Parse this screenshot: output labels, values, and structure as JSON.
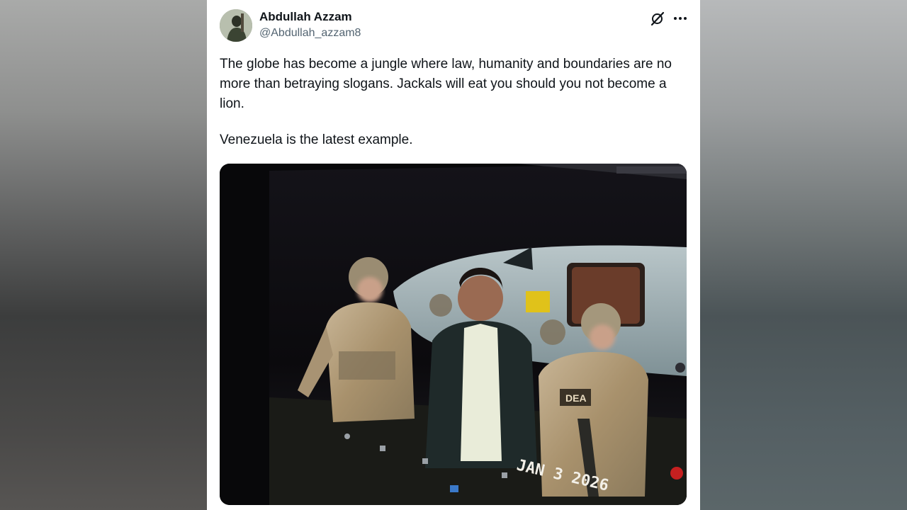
{
  "tweet": {
    "author_name": "Abdullah Azzam",
    "author_handle": "@Abdullah_azzam8",
    "text_paragraphs": [
      "The globe has become a jungle where law, humanity and boundaries are no more than betraying slogans. Jackals will eat you should you not become a lion.",
      "Venezuela is the latest example."
    ],
    "header_icons": [
      "grok-icon",
      "more-icon"
    ]
  },
  "media": {
    "patch_text": "DEA",
    "date_stamp": "JAN 3 2026"
  },
  "colors": {
    "name": "#0f1419",
    "handle": "#536471",
    "card_bg": "#ffffff"
  }
}
